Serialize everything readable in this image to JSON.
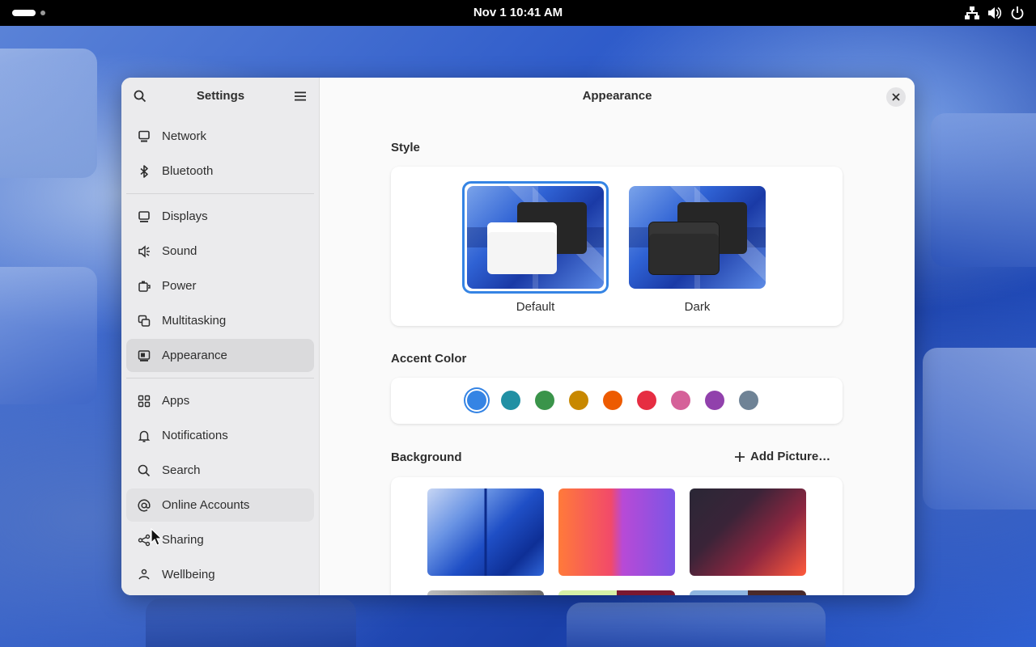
{
  "topbar": {
    "datetime": "Nov 1  10:41 AM",
    "tray_icons": [
      "network-wired-icon",
      "volume-icon",
      "power-icon"
    ]
  },
  "sidebar": {
    "title": "Settings",
    "groups": [
      [
        {
          "label": "Network",
          "icon": "network-icon"
        },
        {
          "label": "Bluetooth",
          "icon": "bluetooth-icon"
        }
      ],
      [
        {
          "label": "Displays",
          "icon": "display-icon"
        },
        {
          "label": "Sound",
          "icon": "speaker-icon"
        },
        {
          "label": "Power",
          "icon": "battery-icon"
        },
        {
          "label": "Multitasking",
          "icon": "multitasking-icon"
        },
        {
          "label": "Appearance",
          "icon": "appearance-icon",
          "active": true
        }
      ],
      [
        {
          "label": "Apps",
          "icon": "apps-grid-icon"
        },
        {
          "label": "Notifications",
          "icon": "bell-icon"
        },
        {
          "label": "Search",
          "icon": "search-icon"
        },
        {
          "label": "Online Accounts",
          "icon": "at-sign-icon",
          "hover": true
        },
        {
          "label": "Sharing",
          "icon": "share-icon"
        },
        {
          "label": "Wellbeing",
          "icon": "wellbeing-icon"
        }
      ]
    ]
  },
  "main": {
    "title": "Appearance",
    "style": {
      "label": "Style",
      "options": [
        {
          "label": "Default",
          "selected": true
        },
        {
          "label": "Dark",
          "selected": false
        }
      ]
    },
    "accent": {
      "label": "Accent Color",
      "colors": [
        "#3584e4",
        "#2190a4",
        "#3a944a",
        "#c88800",
        "#ed5b00",
        "#e62d42",
        "#d56199",
        "#9141ac",
        "#6f8396"
      ],
      "selected_index": 0
    },
    "background": {
      "label": "Background",
      "add_label": "Add Picture…"
    }
  }
}
